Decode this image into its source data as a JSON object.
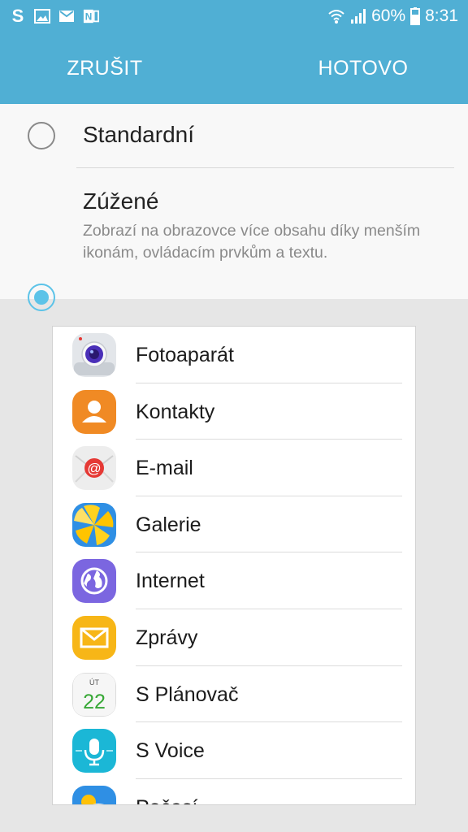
{
  "status_bar": {
    "left_icons": [
      "s-app-icon",
      "gallery-notification-icon",
      "email-notification-icon",
      "onenote-icon"
    ],
    "wifi_icon": "wifi-icon",
    "signal_icon": "signal-icon",
    "battery_percent": "60%",
    "battery_icon": "battery-icon",
    "time": "8:31"
  },
  "action_bar": {
    "cancel_label": "ZRUŠIT",
    "done_label": "HOTOVO"
  },
  "options": [
    {
      "title": "Standardní",
      "selected": false
    },
    {
      "title": "Zúžené",
      "description": "Zobrazí na obrazovce více obsahu díky menším ikonám, ovládacím prvkům a textu.",
      "selected": true
    }
  ],
  "preview": {
    "apps": [
      {
        "label": "Fotoaparát",
        "icon": "camera-icon"
      },
      {
        "label": "Kontakty",
        "icon": "contacts-icon"
      },
      {
        "label": "E-mail",
        "icon": "email-icon"
      },
      {
        "label": "Galerie",
        "icon": "gallery-icon"
      },
      {
        "label": "Internet",
        "icon": "internet-icon"
      },
      {
        "label": "Zprávy",
        "icon": "messages-icon"
      },
      {
        "label": "S Plánovač",
        "icon": "calendar-icon",
        "calendar_day": "ÚT",
        "calendar_date": "22"
      },
      {
        "label": "S Voice",
        "icon": "voice-icon"
      },
      {
        "label": "Počasí",
        "icon": "weather-icon"
      }
    ]
  },
  "colors": {
    "header": "#50afd4",
    "radio_selected": "#5cc3e8",
    "background": "#e6e6e6"
  }
}
